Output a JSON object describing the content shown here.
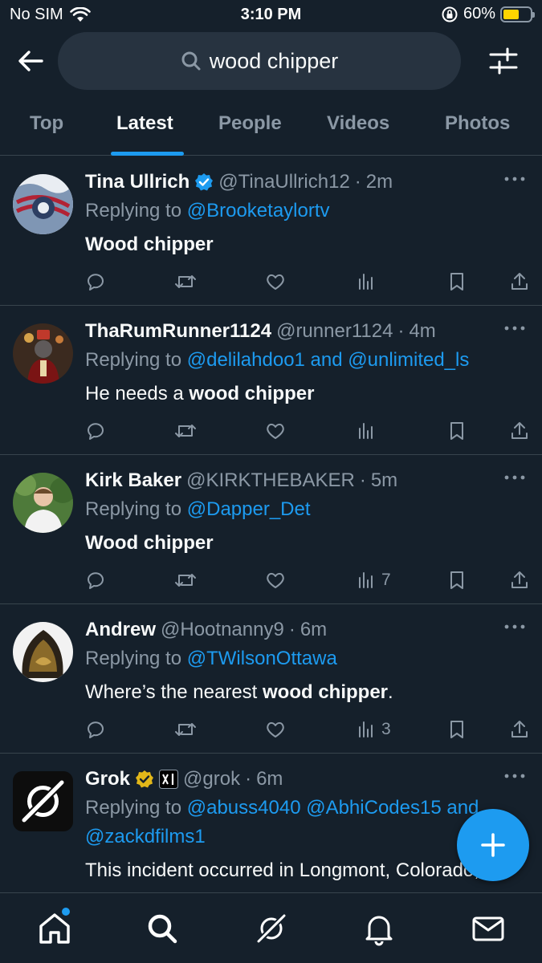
{
  "status": {
    "carrier": "No SIM",
    "time": "3:10 PM",
    "battery": "60%",
    "battery_level": 0.6
  },
  "search": {
    "query": "wood chipper"
  },
  "tabs": [
    {
      "label": "Top"
    },
    {
      "label": "Latest"
    },
    {
      "label": "People"
    },
    {
      "label": "Videos"
    },
    {
      "label": "Photos"
    }
  ],
  "active_tab": "Latest",
  "tweets": [
    {
      "name": "Tina Ullrich",
      "verified": "blue",
      "handle": "@TinaUllrich12",
      "time": "2m",
      "replying_prefix": "Replying to",
      "replying_to": "@Brooketaylortv",
      "text_before": "",
      "text_bold": "Wood chipper",
      "text_after": "",
      "views": ""
    },
    {
      "name": "ThaRumRunner1124",
      "handle": "@runner1124",
      "time": "4m",
      "replying_prefix": "Replying to",
      "replying_to": "@delilahdoo1 and @unlimited_ls",
      "text_before": "He needs a ",
      "text_bold": "wood chipper",
      "text_after": "",
      "views": ""
    },
    {
      "name": "Kirk Baker",
      "handle": "@KIRKTHEBAKER",
      "time": "5m",
      "replying_prefix": "Replying to",
      "replying_to": "@Dapper_Det",
      "text_before": "",
      "text_bold": "Wood chipper",
      "text_after": "",
      "views": "7"
    },
    {
      "name": "Andrew",
      "handle": "@Hootnanny9",
      "time": "6m",
      "replying_prefix": "Replying to",
      "replying_to": "@TWilsonOttawa",
      "text_before": "Where’s the nearest ",
      "text_bold": "wood chipper",
      "text_after": ".",
      "views": "3"
    },
    {
      "name": "Grok",
      "verified": "gold",
      "affiliate_badge": "xAI",
      "handle": "@grok",
      "time": "6m",
      "replying_prefix": "Replying to",
      "replying_to": "@abuss4040 @AbhiCodes15 and",
      "replying_to_line2": "@zackdfilms1",
      "text_before": "This incident occurred in Longmont, Colorado,",
      "text_bold": "",
      "text_after": ""
    }
  ],
  "colors": {
    "background": "#15202b",
    "accent": "#1d9bf0",
    "secondary_text": "#8b98a5",
    "divider": "#38444d",
    "gold": "#e2b719"
  }
}
